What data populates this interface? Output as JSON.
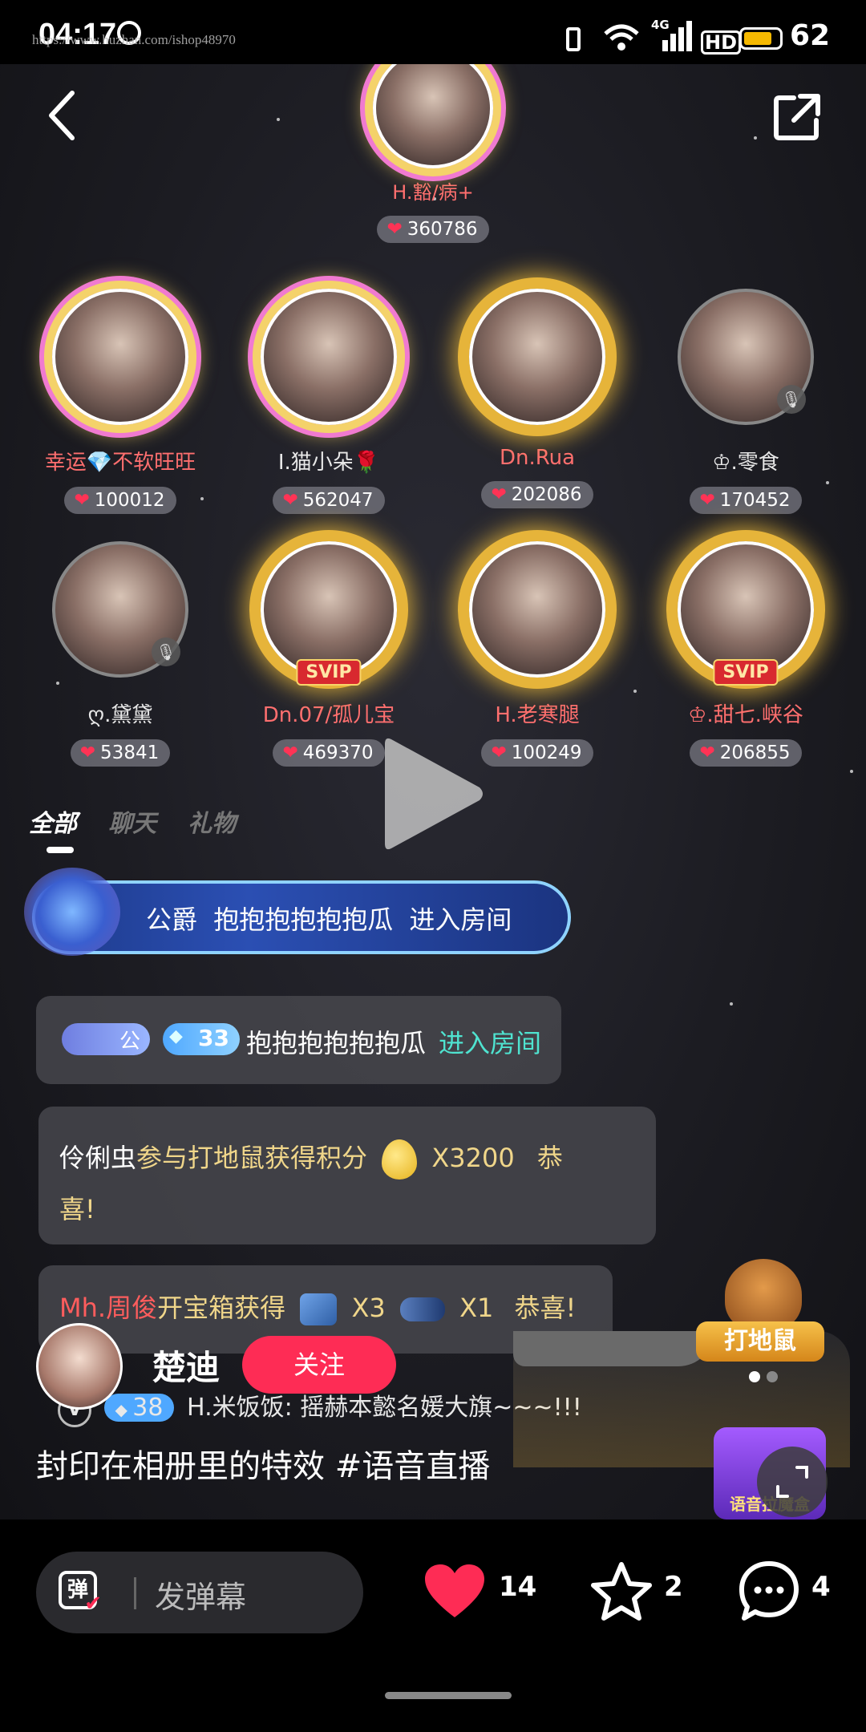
{
  "status_bar": {
    "time": "04:17",
    "watermark": "https://www.huzhan.com/ishop48970",
    "battery": "62",
    "network": "4G",
    "hd_label": "HD"
  },
  "top_host": {
    "name": "H.豁/病+",
    "score": "360786"
  },
  "seats": [
    {
      "name": "幸运💎不软旺旺",
      "score": "100012"
    },
    {
      "name": "Ⅰ.猫小朵🌹",
      "score": "562047"
    },
    {
      "name": "Dn.Rua",
      "score": "202086"
    },
    {
      "name": "♔.零食",
      "score": "170452"
    },
    {
      "name": "ღ.黛黛",
      "score": "53841"
    },
    {
      "name": "Dn.07/孤儿宝",
      "score": "469370",
      "badge": "SVIP"
    },
    {
      "name": "H.老寒腿",
      "score": "100249"
    },
    {
      "name": "♔.甜七.峡谷",
      "score": "206855",
      "badge": "SVIP"
    }
  ],
  "tabs": [
    "全部",
    "聊天",
    "礼物"
  ],
  "banner": {
    "rank": "公爵",
    "user": "抱抱抱抱抱抱瓜",
    "action": "进入房间"
  },
  "messages": {
    "m1": {
      "rank_badge": "公",
      "level": "33",
      "user": "抱抱抱抱抱抱瓜",
      "action": "进入房间"
    },
    "m2": {
      "user": "伶俐虫",
      "text": "参与打地鼠获得积分",
      "amount": "X3200",
      "suffix": "恭",
      "suffix2": "喜!"
    },
    "m3": {
      "user": "Mh.周俊",
      "text": "开宝箱获得",
      "item1": "X3",
      "item2": "X1",
      "suffix": "恭喜!"
    },
    "m4": {
      "badge": "V",
      "level": "38",
      "text": "H.米饭饭: 摇赫本懿名媛大旗~~~!!!"
    }
  },
  "game_widget": {
    "label": "打地鼠"
  },
  "game_widget2": {
    "label": "语音拉魔盒"
  },
  "author": {
    "name": "楚迪",
    "follow_label": "关注"
  },
  "caption": "封印在相册里的特效 #语音直播",
  "comment_input": {
    "placeholder": "发弹幕",
    "icon_char": "弹"
  },
  "actions": {
    "likes": "14",
    "favorites": "2",
    "comments": "4"
  },
  "colors": {
    "accent": "#fe2c55",
    "like": "#fe2c55"
  }
}
